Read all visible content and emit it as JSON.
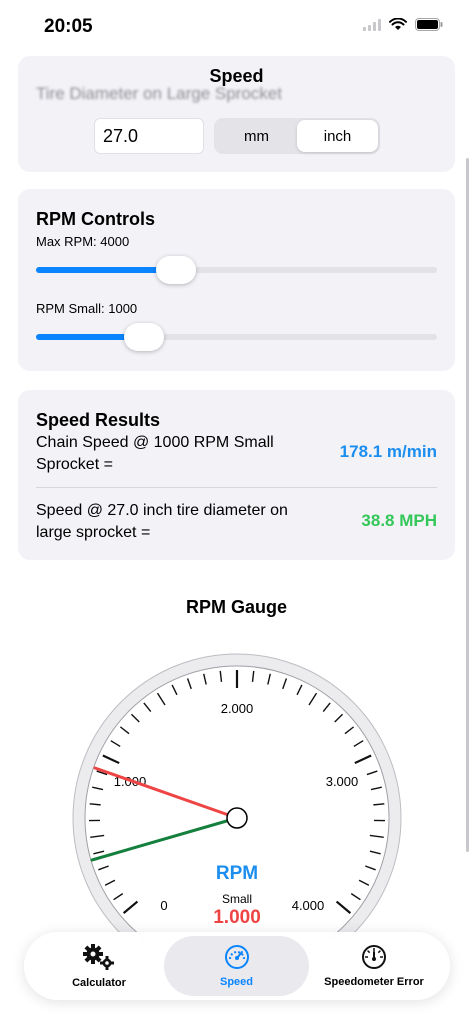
{
  "status": {
    "time": "20:05"
  },
  "speed_section": {
    "title": "Speed",
    "subtitle": "Tire Diameter on Large Sprocket",
    "diameter_value": "27.0",
    "unit_options": [
      "mm",
      "inch"
    ],
    "selected_unit": "inch"
  },
  "rpm_controls": {
    "title": "RPM Controls",
    "max_label": "Max RPM: 4000",
    "max_fraction": 0.35,
    "small_label": "RPM Small: 1000",
    "small_fraction": 0.27
  },
  "results": {
    "title": "Speed Results",
    "chain_label": "Chain Speed @ 1000 RPM Small Sprocket =",
    "chain_value": "178.1 m/min",
    "speed_label": "Speed @ 27.0 inch tire diameter on large sprocket =",
    "speed_value": "38.8 MPH",
    "colors": {
      "chain": "#1c8ef0",
      "speed": "#34c759"
    }
  },
  "gauge": {
    "title": "RPM Gauge",
    "tick_labels": [
      "0",
      "1.000",
      "2.000",
      "3.000",
      "4.000"
    ],
    "unit_label": "RPM",
    "small_label": "Small",
    "small_value": "1.000",
    "colors": {
      "max_needle": "#ef4444",
      "small_needle": "#15803d",
      "unit": "#1c8ef0",
      "value": "#ef4444"
    }
  },
  "tabs": [
    {
      "label": "Calculator",
      "icon": "gears-icon"
    },
    {
      "label": "Speed",
      "icon": "speedometer-icon",
      "selected": true
    },
    {
      "label": "Speedometer Error",
      "icon": "gauge-icon"
    }
  ]
}
